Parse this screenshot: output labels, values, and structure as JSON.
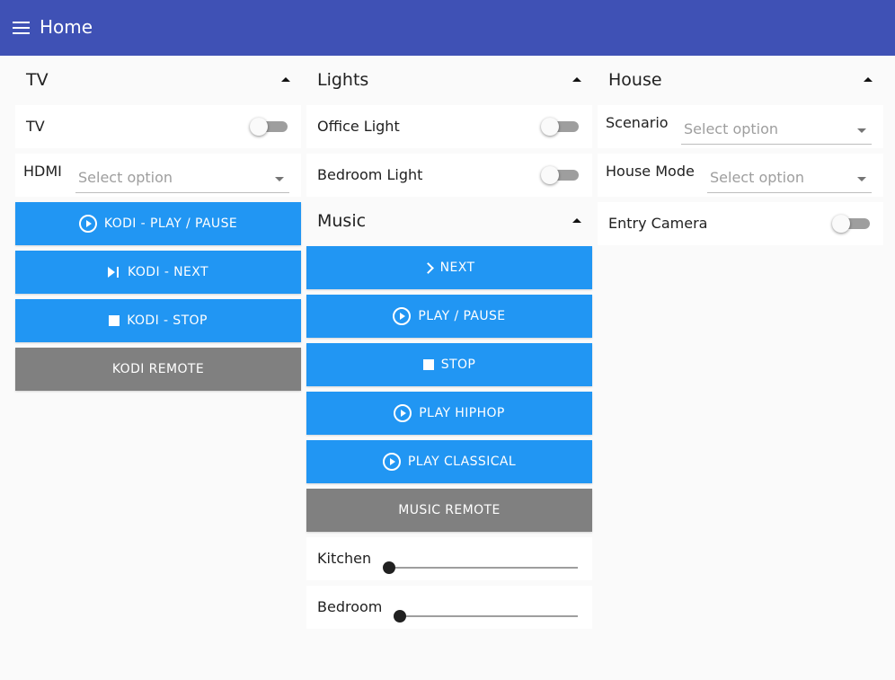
{
  "header": {
    "title": "Home",
    "menu_icon": "menu-icon"
  },
  "columns": {
    "tv": {
      "title": "TV",
      "tv_toggle": {
        "label": "TV",
        "on": false
      },
      "hdmi": {
        "label": "HDMI",
        "placeholder": "Select option"
      },
      "buttons": {
        "play_pause": {
          "label": "KODI - PLAY / PAUSE",
          "icon": "play-circle-icon"
        },
        "next": {
          "label": "KODI - NEXT",
          "icon": "skip-next-icon"
        },
        "stop": {
          "label": "KODI - STOP",
          "icon": "stop-icon"
        },
        "remote": {
          "label": "KODI REMOTE"
        }
      }
    },
    "lights": {
      "title": "Lights",
      "office": {
        "label": "Office Light",
        "on": false
      },
      "bedroom": {
        "label": "Bedroom Light",
        "on": false
      }
    },
    "music": {
      "title": "Music",
      "buttons": {
        "next": {
          "label": "NEXT",
          "icon": "chevron-right-icon"
        },
        "play_pause": {
          "label": "PLAY / PAUSE",
          "icon": "play-circle-icon"
        },
        "stop": {
          "label": "STOP",
          "icon": "stop-icon"
        },
        "hiphop": {
          "label": "PLAY HIPHOP",
          "icon": "play-circle-icon"
        },
        "classical": {
          "label": "PLAY CLASSICAL",
          "icon": "play-circle-icon"
        },
        "remote": {
          "label": "MUSIC REMOTE"
        }
      },
      "kitchen": {
        "label": "Kitchen",
        "value": 0
      },
      "bedroom": {
        "label": "Bedroom",
        "value": 0
      }
    },
    "house": {
      "title": "House",
      "scenario": {
        "label": "Scenario",
        "placeholder": "Select option"
      },
      "mode": {
        "label": "House Mode",
        "placeholder": "Select option"
      },
      "camera": {
        "label": "Entry Camera",
        "on": false
      }
    }
  },
  "colors": {
    "header": "#3f51b5",
    "button_primary": "#2196f3",
    "button_secondary": "#808080",
    "background": "#fafafa"
  }
}
